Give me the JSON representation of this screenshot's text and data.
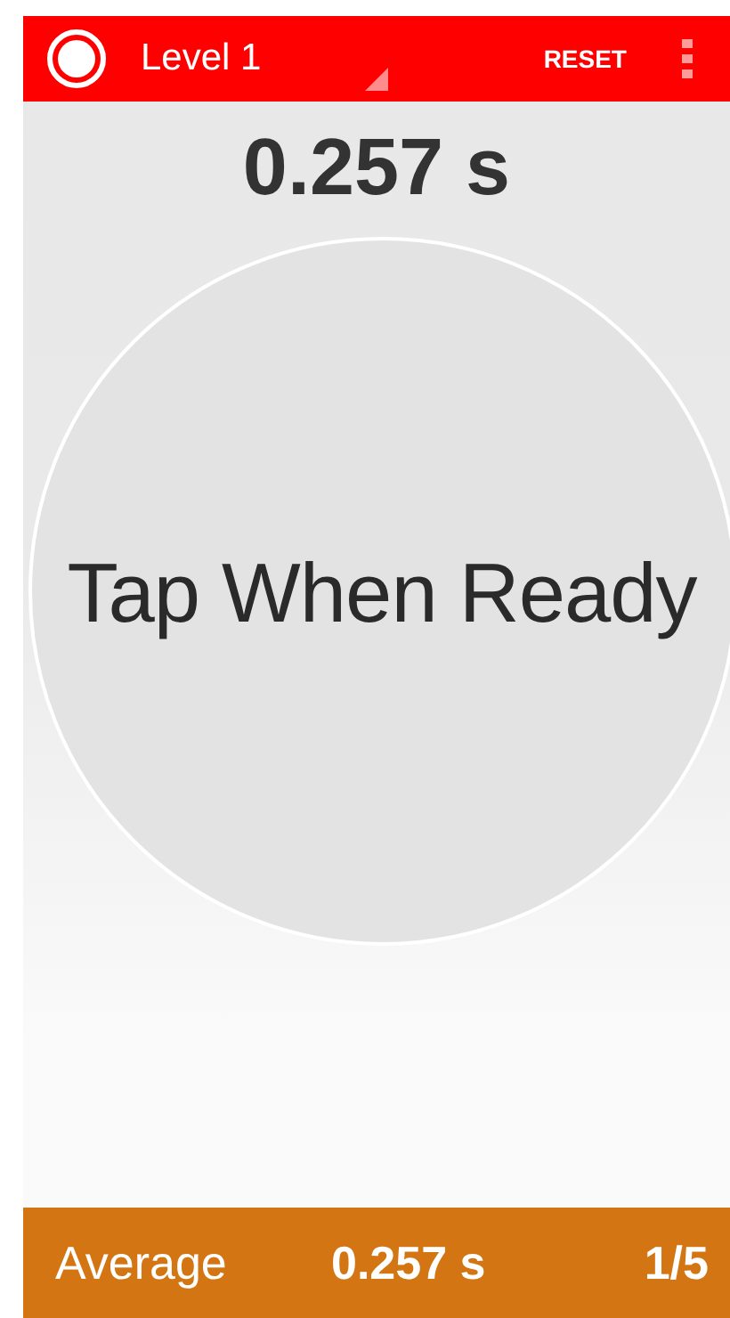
{
  "app_bar": {
    "title": "Level 1",
    "action": "RESET"
  },
  "last_time": "0.257 s",
  "tap_target": {
    "label": "Tap When Ready"
  },
  "footer": {
    "label": "Average",
    "average": "0.257 s",
    "progress": "1/5"
  }
}
